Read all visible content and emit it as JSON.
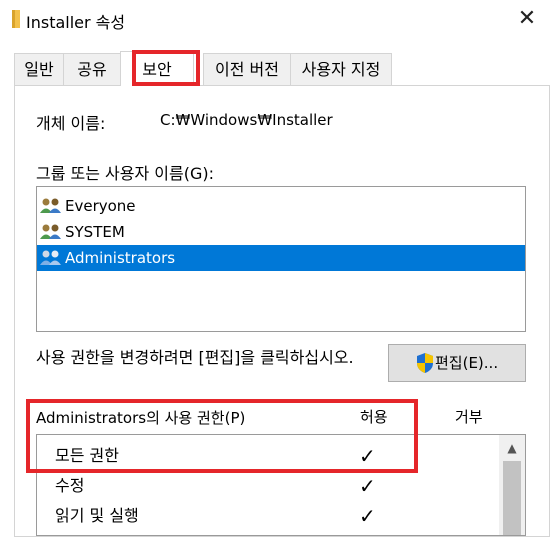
{
  "window": {
    "title": "Installer 속성",
    "close_glyph": "✕",
    "folder_icon": "folder-icon"
  },
  "tabs": [
    {
      "label": "일반"
    },
    {
      "label": "공유"
    },
    {
      "label": "보안",
      "active": true
    },
    {
      "label": "이전 버전"
    },
    {
      "label": "사용자 지정"
    }
  ],
  "security": {
    "object_name_label": "개체 이름:",
    "object_name_value": "C:₩Windows₩Installer",
    "groups_label": "그룹 또는 사용자 이름(G):",
    "users": [
      {
        "name": "Everyone",
        "icon": "users-icon"
      },
      {
        "name": "SYSTEM",
        "icon": "users-icon"
      },
      {
        "name": "Administrators",
        "icon": "users-icon",
        "selected": true
      }
    ],
    "change_hint": "사용 권한을 변경하려면 [편집]을 클릭하십시오.",
    "edit_button": "편집(E)...",
    "permissions_label": "Administrators의 사용 권한(P)",
    "allow_header": "허용",
    "deny_header": "거부",
    "permissions": [
      {
        "name": "모든 권한",
        "allow": "✓",
        "deny": ""
      },
      {
        "name": "수정",
        "allow": "✓",
        "deny": ""
      },
      {
        "name": "읽기 및 실행",
        "allow": "✓",
        "deny": ""
      }
    ]
  },
  "colors": {
    "highlight_red": "#e5262a",
    "selection_blue": "#0078d7"
  }
}
